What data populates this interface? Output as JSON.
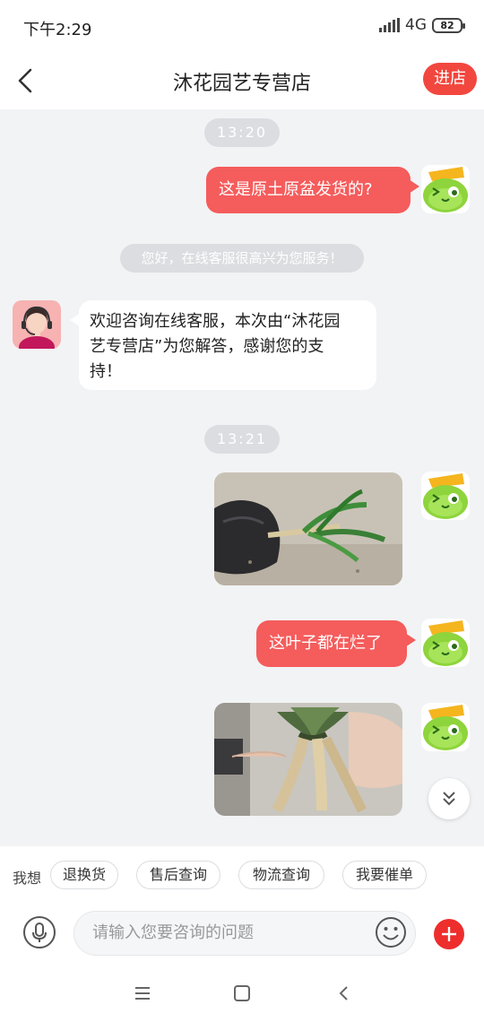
{
  "status_bar": {
    "time": "下午2:29",
    "network": "4G",
    "battery": "82",
    "icons": [
      "signal-icon",
      "battery-icon"
    ]
  },
  "header": {
    "title": "沐花园艺专营店",
    "enter_store_label": "进店",
    "back_icon": "back-arrow-icon"
  },
  "messages": {
    "time_1": "13:20",
    "msg_1": "这是原土原盆发货的?",
    "notice": "您好，在线客服很高兴为您服务！",
    "agent_line_1": "欢迎咨询在线客服，本次由“沐花园",
    "agent_line_2": "艺专营店”为您解答，感谢您的支",
    "agent_line_3": "持！",
    "time_2": "13:21",
    "msg_2": "这叶子都在烂了"
  },
  "quick_replies": {
    "label": "我想",
    "chips": [
      "退换货",
      "售后查询",
      "物流查询",
      "我要催单"
    ]
  },
  "input": {
    "placeholder": "请输入您要咨询的问题"
  },
  "colors": {
    "accent": "#f2473f",
    "outgoing_bubble": "#f55c5c",
    "chat_background": "#f2f3f5",
    "time_pill": "#dcdde1"
  }
}
